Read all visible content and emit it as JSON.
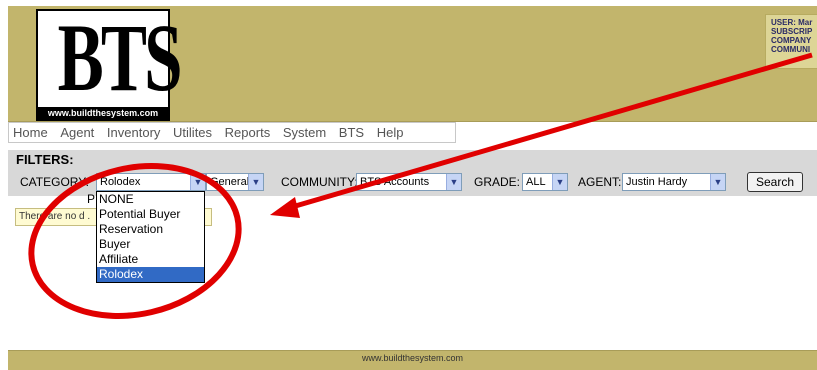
{
  "logo": {
    "text": "BTS",
    "url": "www.buildthesystem.com"
  },
  "user_panel": {
    "lines": [
      "USER: Mar",
      "SUBSCRIP",
      "COMPANY",
      "COMMUNI"
    ]
  },
  "menu": [
    "Home",
    "Agent",
    "Inventory",
    "Utilites",
    "Reports",
    "System",
    "BTS",
    "Help"
  ],
  "filters": {
    "title": "FILTERS:",
    "category_label": "CATEGORY:",
    "category_value": "Rolodex",
    "type_value": "General",
    "community_label": "COMMUNITY:",
    "community_value": "BTS Accounts",
    "grade_label": "GRADE:",
    "grade_value": "ALL",
    "agent_label": "AGENT:",
    "agent_value": "Justin Hardy",
    "search_label": "Search"
  },
  "partial_text": "P",
  "message": "There are no d                              .",
  "dropdown_options": [
    "NONE",
    "Potential Buyer",
    "Reservation",
    "Buyer",
    "Affiliate",
    "Rolodex"
  ],
  "dropdown_selected": "Rolodex",
  "footer": "www.buildthesystem.com",
  "colors": {
    "header": "#c2b56c",
    "annotation": "#e00000",
    "selection": "#316ac5"
  }
}
